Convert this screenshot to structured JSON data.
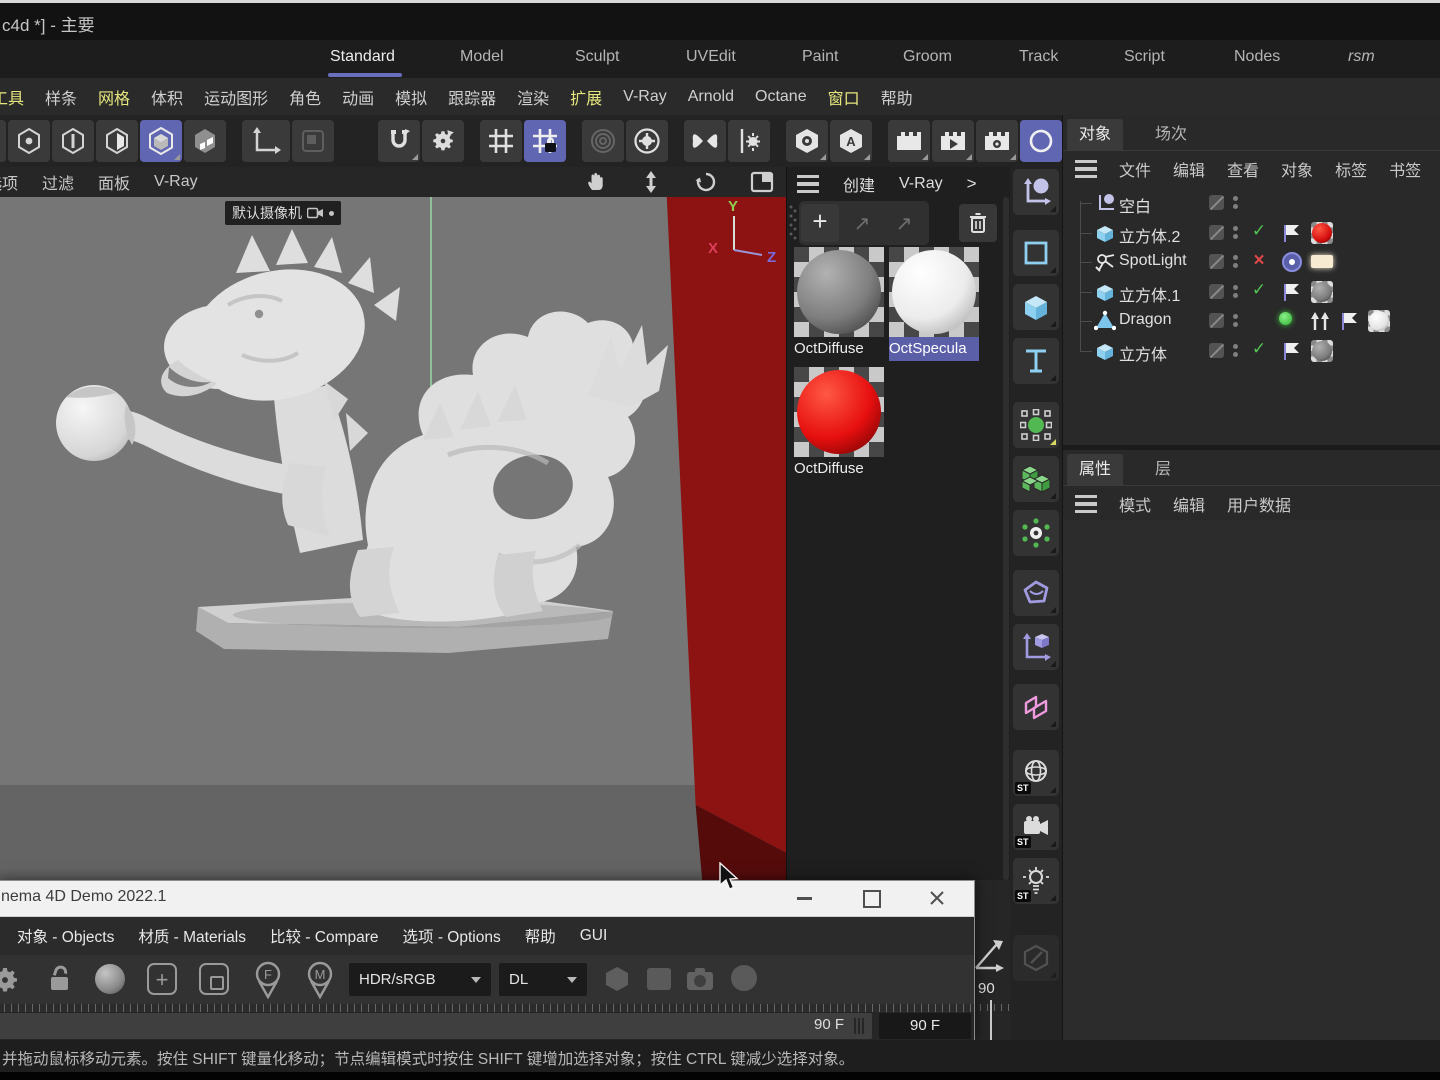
{
  "window_title": "c4d *] - 主要",
  "workspace_tabs": {
    "items": [
      {
        "label": "Standard"
      },
      {
        "label": "Model"
      },
      {
        "label": "Sculpt"
      },
      {
        "label": "UVEdit"
      },
      {
        "label": "Paint"
      },
      {
        "label": "Groom"
      },
      {
        "label": "Track"
      },
      {
        "label": "Script"
      },
      {
        "label": "Nodes"
      },
      {
        "label": "rsm"
      }
    ],
    "active": "Standard"
  },
  "menu_bar": {
    "items": [
      {
        "label": "工具",
        "highlight": true
      },
      {
        "label": "样条",
        "highlight": false
      },
      {
        "label": "网格",
        "highlight": true
      },
      {
        "label": "体积",
        "highlight": false
      },
      {
        "label": "运动图形",
        "highlight": false
      },
      {
        "label": "角色",
        "highlight": false
      },
      {
        "label": "动画",
        "highlight": false
      },
      {
        "label": "模拟",
        "highlight": false
      },
      {
        "label": "跟踪器",
        "highlight": false
      },
      {
        "label": "渲染",
        "highlight": false
      },
      {
        "label": "扩展",
        "highlight": true
      },
      {
        "label": "V-Ray",
        "highlight": false
      },
      {
        "label": "Arnold",
        "highlight": false
      },
      {
        "label": "Octane",
        "highlight": false
      },
      {
        "label": "窗口",
        "highlight": true
      },
      {
        "label": "帮助",
        "highlight": false
      }
    ]
  },
  "viewport": {
    "menu": [
      "选项",
      "过滤",
      "面板",
      "V-Ray"
    ],
    "camera_label": "默认摄像机",
    "axis_labels": {
      "x": "X",
      "y": "Y",
      "z": "Z"
    }
  },
  "materials_panel": {
    "menu_create": "创建",
    "menu_vray": "V-Ray",
    "more": ">",
    "materials": [
      {
        "name": "OctDiffuse",
        "kind": "gray",
        "selected": false
      },
      {
        "name": "OctSpecula",
        "kind": "white",
        "selected": true
      },
      {
        "name": "OctDiffuse",
        "kind": "red",
        "selected": false
      }
    ]
  },
  "object_manager": {
    "tab_objects": "对象",
    "tab_takes": "场次",
    "menu": [
      "文件",
      "编辑",
      "查看",
      "对象",
      "标签",
      "书签"
    ],
    "objects": [
      {
        "name": "空白",
        "icon": "null",
        "state": "none"
      },
      {
        "name": "立方体.2",
        "icon": "cube",
        "state": "check"
      },
      {
        "name": "SpotLight",
        "icon": "spotlight",
        "state": "cross"
      },
      {
        "name": "立方体.1",
        "icon": "cube",
        "state": "check"
      },
      {
        "name": "Dragon",
        "icon": "polygon",
        "state": "dot"
      },
      {
        "name": "立方体",
        "icon": "cube",
        "state": "check"
      }
    ]
  },
  "attribute_manager": {
    "tab_attributes": "属性",
    "tab_layers": "层",
    "menu": [
      "模式",
      "编辑",
      "用户数据"
    ]
  },
  "demo_window": {
    "title": "nema 4D Demo 2022.1",
    "menu": [
      "对象 - Objects",
      "材质 - Materials",
      "比较 - Compare",
      "选项 - Options",
      "帮助",
      "GUI"
    ],
    "colorspace": "HDR/sRGB",
    "kernel": "DL",
    "frame_end": "90 F",
    "frame_current": "90 F"
  },
  "timeline": {
    "frame": "90"
  },
  "status_bar": {
    "text": "并拖动鼠标移动元素。按住 SHIFT 键量化移动；节点编辑模式时按住 SHIFT 键增加选择对象；按住 CTRL 键减少选择对象。"
  },
  "colors": {
    "accent": "#6166b2",
    "highlight_menu": "#e6e67e",
    "check": "#52c552",
    "cross": "#e04848",
    "red_material": "#e01010"
  }
}
